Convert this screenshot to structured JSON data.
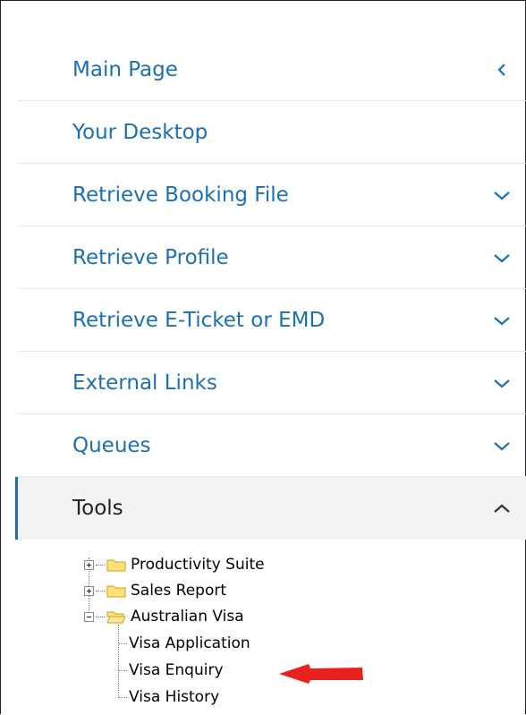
{
  "menu": {
    "items": [
      {
        "label": "Main Page",
        "chevron": "left"
      },
      {
        "label": "Your Desktop",
        "chevron": "none"
      },
      {
        "label": "Retrieve Booking File",
        "chevron": "down"
      },
      {
        "label": "Retrieve Profile",
        "chevron": "down"
      },
      {
        "label": "Retrieve E-Ticket or EMD",
        "chevron": "down"
      },
      {
        "label": "External Links",
        "chevron": "down"
      },
      {
        "label": "Queues",
        "chevron": "down"
      },
      {
        "label": "Tools",
        "chevron": "up",
        "active": true
      }
    ]
  },
  "tree": {
    "folders": [
      {
        "label": "Productivity Suite",
        "expanded": false
      },
      {
        "label": "Sales Report",
        "expanded": false
      },
      {
        "label": "Australian Visa",
        "expanded": true
      }
    ],
    "children": [
      {
        "label": "Visa Application"
      },
      {
        "label": "Visa Enquiry"
      },
      {
        "label": "Visa History"
      }
    ]
  },
  "colors": {
    "link": "#1b6fb5",
    "active_text": "#222222",
    "active_bg": "#f3f3f3",
    "folder_fill": "#ffe27a",
    "folder_stroke": "#c9a21c",
    "annotation_arrow": "#e8201e"
  },
  "icons": {
    "folder": "folder-icon",
    "expander_plus": "plus-box-icon",
    "expander_minus": "minus-box-icon",
    "chevron_down": "chevron-down-icon",
    "chevron_up": "chevron-up-icon",
    "chevron_left": "chevron-left-icon",
    "annotation": "red-arrow-icon"
  }
}
